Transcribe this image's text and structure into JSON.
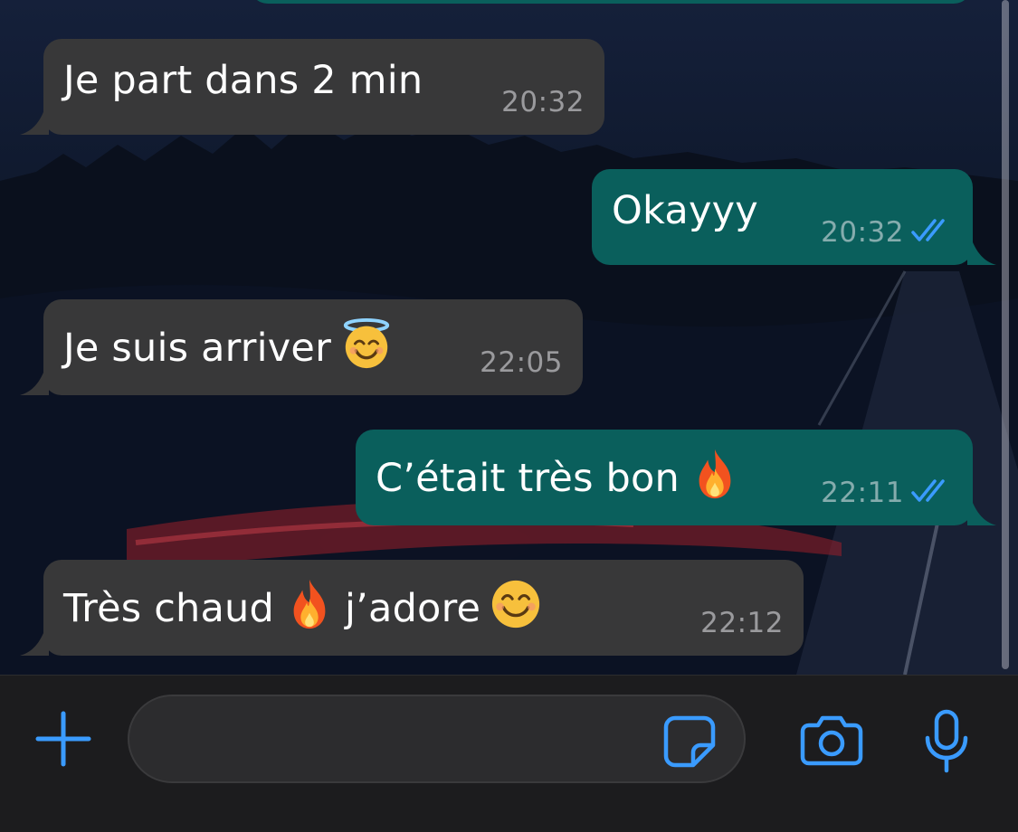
{
  "theme": {
    "accent": "#3a9bff",
    "incoming_bubble": "#383839",
    "outgoing_bubble": "#0a5f5c"
  },
  "messages": [
    {
      "direction": "incoming",
      "text": "Je part dans 2 min",
      "time": "20:32"
    },
    {
      "direction": "outgoing",
      "text": "Okayyy",
      "time": "20:32",
      "status": "read"
    },
    {
      "direction": "incoming",
      "text": "Je suis arriver",
      "emoji": "smiling-face-with-halo",
      "time": "22:05"
    },
    {
      "direction": "outgoing",
      "text": "C’était très bon",
      "emoji": "fire",
      "time": "22:11",
      "status": "read"
    },
    {
      "direction": "incoming",
      "text_before": "Très chaud",
      "emoji": "fire",
      "text_after": "j’adore",
      "emoji_end": "smiling-face",
      "time": "22:12"
    }
  ],
  "input_bar": {
    "message_value": "",
    "message_placeholder": "",
    "icons": [
      "plus-icon",
      "sticker-icon",
      "camera-icon",
      "microphone-icon"
    ]
  }
}
